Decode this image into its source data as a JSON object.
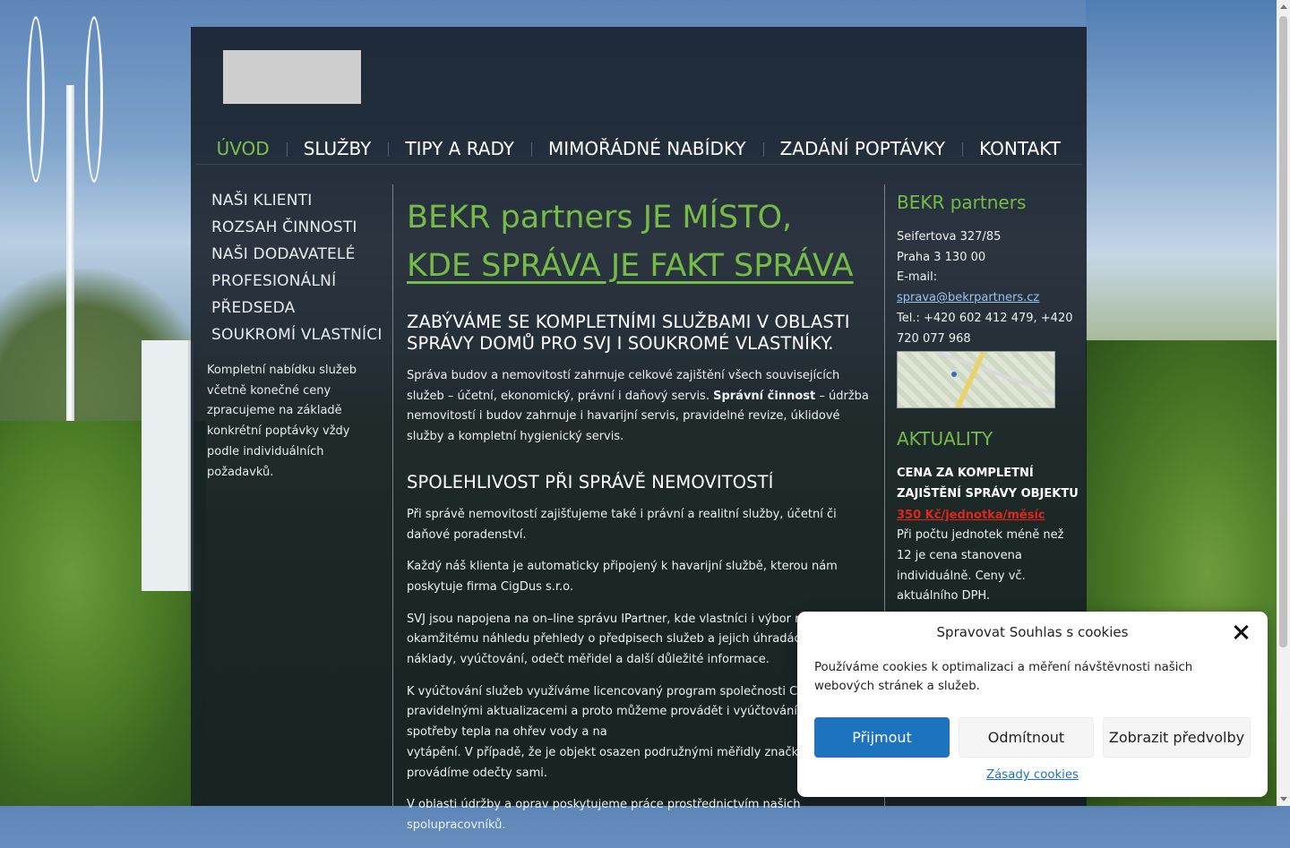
{
  "nav": {
    "items": [
      {
        "label": "ÚVOD",
        "active": true
      },
      {
        "label": "SLUŽBY"
      },
      {
        "label": "TIPY A RADY"
      },
      {
        "label": "MIMOŘÁDNÉ NABÍDKY"
      },
      {
        "label": "ZADÁNÍ POPTÁVKY"
      },
      {
        "label": "KONTAKT"
      }
    ]
  },
  "sidebar": {
    "items": [
      {
        "label": "NAŠI KLIENTI"
      },
      {
        "label": "ROZSAH ČINNOSTI"
      },
      {
        "label": "NAŠI DODAVATELÉ"
      },
      {
        "label": "PROFESIONÁLNÍ"
      },
      {
        "label": "PŘEDSEDA"
      },
      {
        "label": "SOUKROMÍ VLASTNÍCI"
      }
    ],
    "note": "Kompletní nabídku služeb včetně konečné ceny zpracujeme na základě konkrétní poptávky vždy podle individuálních požadavků."
  },
  "main": {
    "headline_line1": "BEKR partners JE MÍSTO,",
    "headline_line2": "KDE SPRÁVA JE FAKT SPRÁVA",
    "h2_1": "ZABÝVÁME SE KOMPLETNÍMI SLUŽBAMI V OBLASTI SPRÁVY DOMŮ PRO SVJ I SOUKROMÉ VLASTNÍKY.",
    "p1_a": "Správa budov a nemovitostí zahrnuje celkové zajištění všech souvisejících služeb – účetní, ekonomický, právní i daňový servis. ",
    "p1_bold": "Správní činnost",
    "p1_b": " – údržba nemovitostí i budov zahrnuje i havarijní servis, pravidelné revize, úklidové služby a kompletní hygienický servis.",
    "h2_2": "SPOLEHLIVOST PŘI SPRÁVĚ NEMOVITOSTÍ",
    "p2": "Při správě nemovitostí zajišťujeme také i právní a realitní služby, účetní či daňové poradenství.",
    "p3": "Každý náš klienta je automaticky připojený k havarijní službě, kterou nám poskytuje firma CigDus s.r.o.",
    "p4": "SVJ jsou napojena na on–line správu IPartner, kde vlastníci i výbor mají k okamžitému náhledu přehledy o předpisech služeb a jejich úhradách, průběžné náklady, vyúčtování, odečt měřidel a další důležité informace.",
    "p5_a": "K vyúčtování služeb využíváme licencovaný program společnosti CSH s. r. o. s pravidelnými aktualizacemi a proto můžeme provádět i vyúčtování/rozúčtování spotřeby tepla na ohřev vody a na",
    "p5_b": "vytápění. V případě, že je objekt osazen podružnými měřidly značky ENBRA, provádíme odečty sami.",
    "p6": "V oblasti údržby a oprav poskytujeme práce prostřednictvím našich spolupracovníků."
  },
  "contact": {
    "title": "BEKR partners",
    "street": "Seifertova 327/85",
    "city": "Praha 3 130 00",
    "email_label": "E-mail: ",
    "email": "sprava@bekrpartners.cz",
    "phone": "Tel.: +420 602 412 479, +420 720 077 968"
  },
  "news": {
    "title": "AKTUALITY",
    "item_title": "CENA ZA KOMPLETNÍ ZAJIŠTĚNÍ SPRÁVY OBJEKTU",
    "price": "350 Kč/jednotka/měsíc",
    "text": "Při počtu jednotek méně než 12 je cena stanovena individuálně. Ceny vč. aktuálního DPH."
  },
  "cookie": {
    "title": "Spravovat Souhlas s cookies",
    "message": "Používáme cookies k optimalizaci a měření návštěvnosti našich webových stránek a služeb.",
    "accept": "Přijmout",
    "deny": "Odmítnout",
    "prefs": "Zobrazit předvolby",
    "policy": "Zásady cookies"
  },
  "colors": {
    "accent_green": "#74bb48",
    "accept_blue": "#1e73be",
    "price_red": "#e0251a"
  }
}
